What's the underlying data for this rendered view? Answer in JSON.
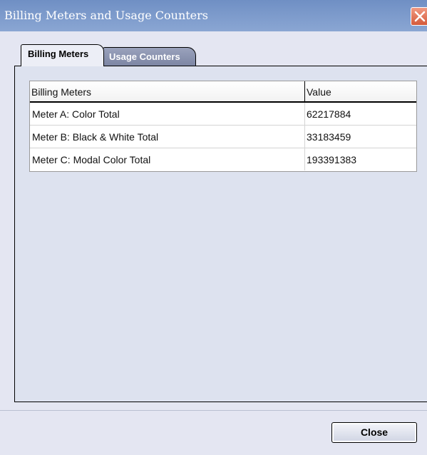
{
  "window": {
    "title": "Billing Meters and Usage Counters"
  },
  "tabs": [
    {
      "label": "Billing Meters",
      "active": true
    },
    {
      "label": "Usage Counters",
      "active": false
    }
  ],
  "table": {
    "headers": [
      "Billing Meters",
      "Value"
    ],
    "rows": [
      {
        "name": "Meter A: Color Total",
        "value": "62217884"
      },
      {
        "name": "Meter B: Black & White Total",
        "value": "33183459"
      },
      {
        "name": "Meter C: Modal Color Total",
        "value": "193391383"
      }
    ]
  },
  "buttons": {
    "close_label": "Close"
  },
  "colors": {
    "titlebar": "#7c9acb",
    "close_x": "#d45a3a",
    "window_bg": "#e4e6f2"
  },
  "icons": {
    "window_close": "close-icon"
  }
}
